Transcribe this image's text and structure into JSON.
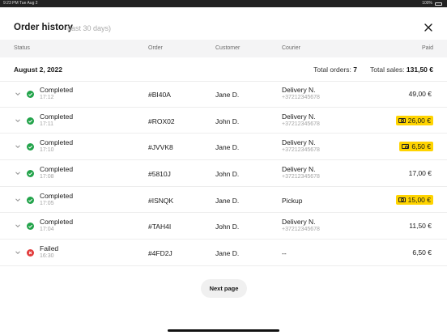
{
  "status_bar": {
    "left": "9:23 PM  Tue Aug 2",
    "right": "100%"
  },
  "header": {
    "title": "Order history",
    "subtitle": "(last 30 days)"
  },
  "columns": {
    "status": "Status",
    "order": "Order",
    "customer": "Customer",
    "courier": "Courier",
    "paid": "Paid"
  },
  "day": {
    "date": "August 2, 2022",
    "total_orders_label": "Total orders:",
    "total_orders_value": "7",
    "total_sales_label": "Total sales:",
    "total_sales_value": "131,50 €"
  },
  "orders": [
    {
      "status": "Completed",
      "state": "ok",
      "time": "17:12",
      "order": "#BI40A",
      "customer": "Jane D.",
      "courier": "Delivery N.",
      "phone": "+37212345678",
      "paid": "49,00 €",
      "highlight": false
    },
    {
      "status": "Completed",
      "state": "ok",
      "time": "17:11",
      "order": "#ROX02",
      "customer": "John D.",
      "courier": "Delivery N.",
      "phone": "+37212345678",
      "paid": "26,00 €",
      "highlight": true
    },
    {
      "status": "Completed",
      "state": "ok",
      "time": "17:10",
      "order": "#JVVK8",
      "customer": "Jane D.",
      "courier": "Delivery N.",
      "phone": "+37212345678",
      "paid": "6,50 €",
      "highlight": true
    },
    {
      "status": "Completed",
      "state": "ok",
      "time": "17:08",
      "order": "#5810J",
      "customer": "John D.",
      "courier": "Delivery N.",
      "phone": "+37212345678",
      "paid": "17,00 €",
      "highlight": false
    },
    {
      "status": "Completed",
      "state": "ok",
      "time": "17:05",
      "order": "#ISNQK",
      "customer": "Jane D.",
      "courier": "Pickup",
      "phone": "",
      "paid": "15,00 €",
      "highlight": true
    },
    {
      "status": "Completed",
      "state": "ok",
      "time": "17:04",
      "order": "#TAH4I",
      "customer": "John D.",
      "courier": "Delivery N.",
      "phone": "+37212345678",
      "paid": "11,50 €",
      "highlight": false
    },
    {
      "status": "Failed",
      "state": "fail",
      "time": "16:30",
      "order": "#4FD2J",
      "customer": "Jane D.",
      "courier": "--",
      "phone": "",
      "paid": "6,50 €",
      "highlight": false
    }
  ],
  "pagination": {
    "next_label": "Next page"
  },
  "colors": {
    "success": "#22a34a",
    "failed": "#e23b3b",
    "highlight": "#ffd400"
  },
  "icons": {
    "close": "close-icon",
    "expand": "chevron-down-icon",
    "completed": "check-circle-icon",
    "failed": "x-circle-icon",
    "cash": "cash-icon"
  }
}
